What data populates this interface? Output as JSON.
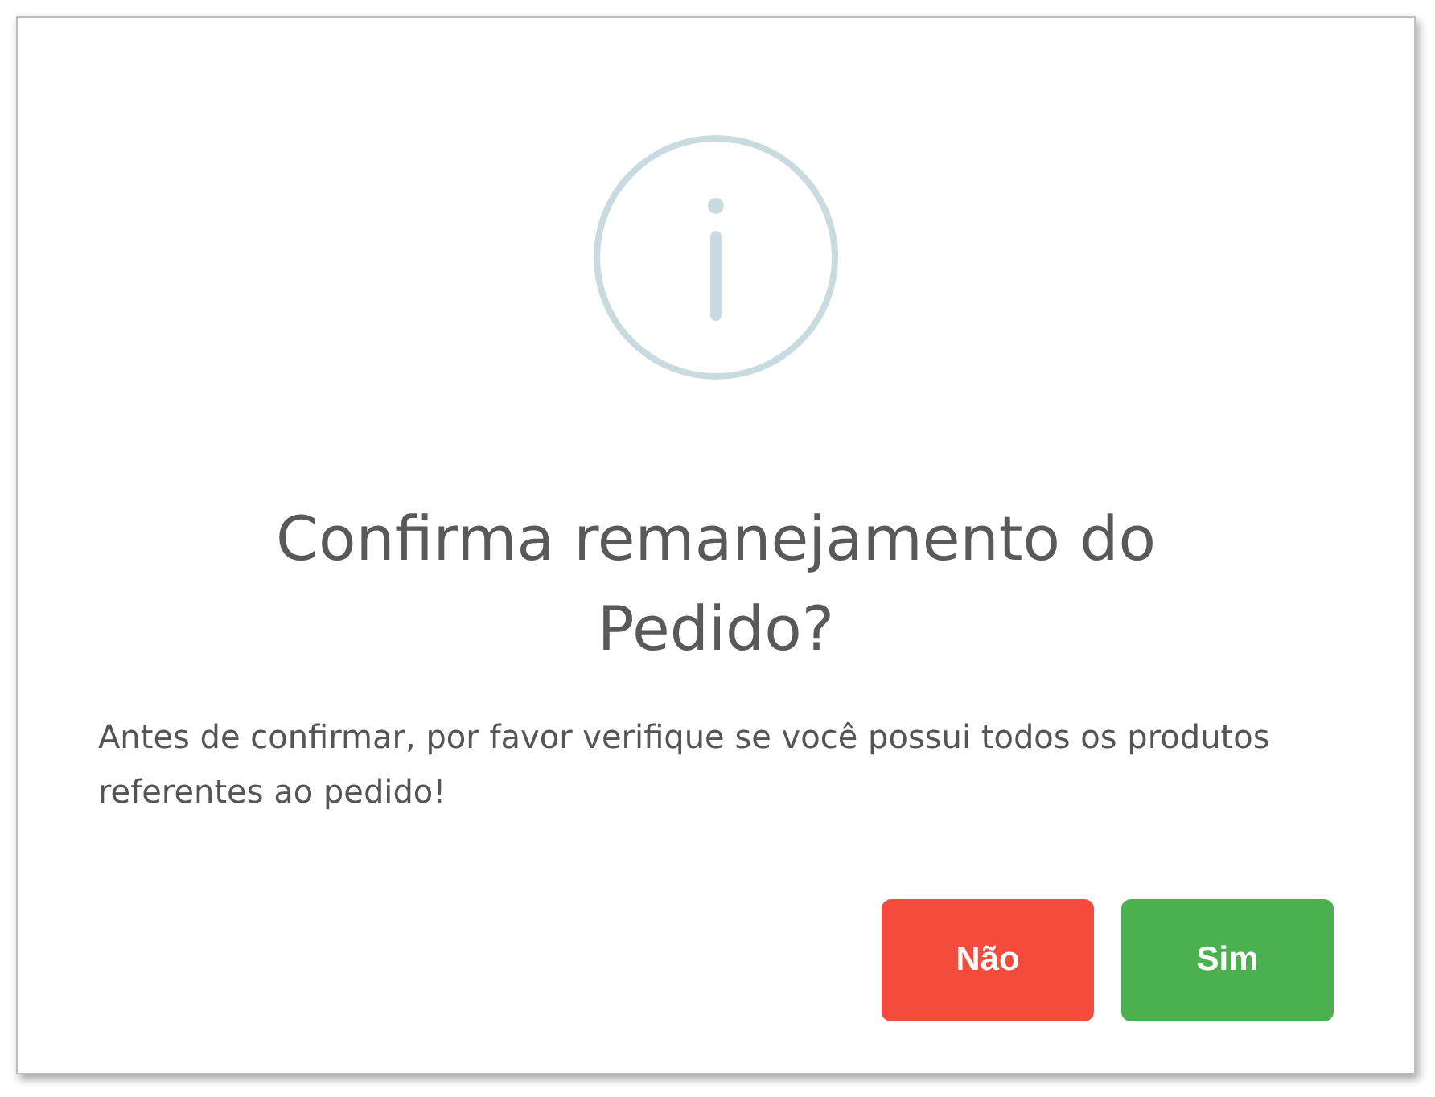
{
  "dialog": {
    "title": "Confirma remanejamento do Pedido?",
    "message": "Antes de confirmar, por favor verifique se você possui todos os produtos referentes ao pedido!",
    "buttons": [
      {
        "label": "Não",
        "kind": "cancel"
      },
      {
        "label": "Sim",
        "kind": "confirm"
      }
    ]
  }
}
